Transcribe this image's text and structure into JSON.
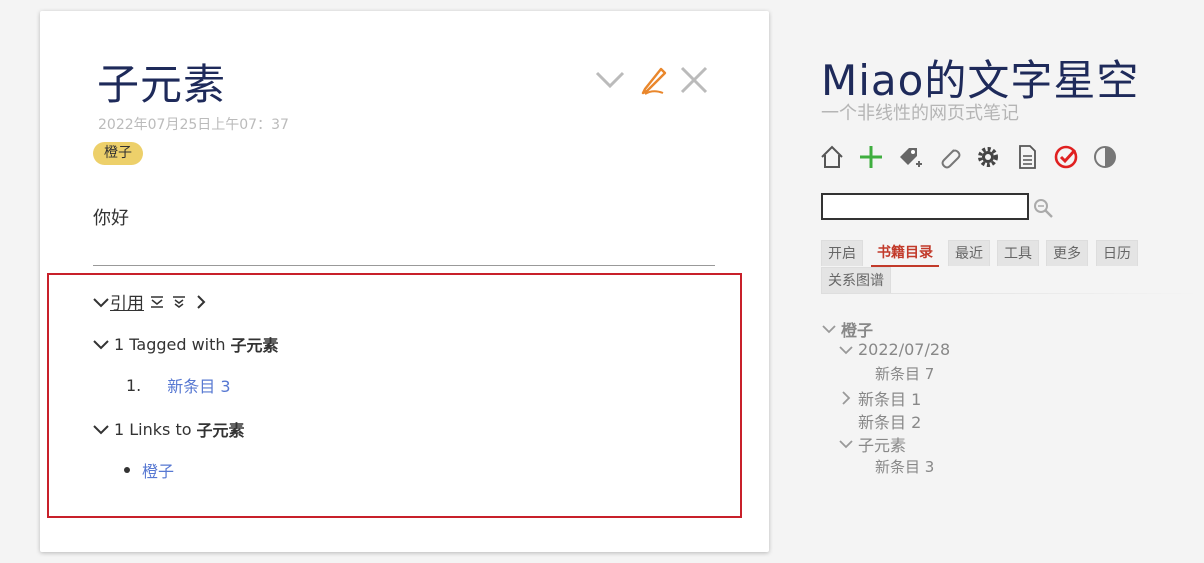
{
  "tiddler": {
    "title": "子元素",
    "subtitle": "2022年07月25日上午07：37",
    "tag": "橙子",
    "body": "你好",
    "controls": [
      "chevron-down-icon",
      "edit-icon",
      "close-icon"
    ],
    "references": {
      "label": "引用",
      "tagged_count": "1 Tagged with",
      "tagged_target": "子元素",
      "tagged_items": [
        {
          "number": "1.",
          "label": "新条目 3"
        }
      ],
      "links_count": "1 Links to",
      "links_target": "子元素",
      "links_items": [
        "橙子"
      ]
    }
  },
  "sidebar": {
    "site_title": "Miao的文字星空",
    "site_subtitle": "一个非线性的网页式笔记",
    "toolbar": [
      "home-icon",
      "new-tiddler-icon",
      "tag-icon",
      "paperclip-icon",
      "gear-icon",
      "document-icon",
      "check-circle-icon",
      "contrast-icon"
    ],
    "search": {
      "value": "",
      "placeholder": ""
    },
    "tabs": [
      "开启",
      "书籍目录",
      "最近",
      "工具",
      "更多",
      "日历",
      "关系图谱"
    ],
    "active_tab": "书籍目录",
    "toc": {
      "root": "橙子",
      "n1": "2022/07/28",
      "n1a": "新条目 7",
      "n2": "新条目 1",
      "n3": "新条目 2",
      "n4": "子元素",
      "n4a": "新条目 3"
    }
  },
  "colors": {
    "accent": "#c23a2a",
    "title": "#1e2a5a",
    "tag": "#edd06a",
    "link": "#5778d2",
    "highlight_border": "#c8202a"
  }
}
